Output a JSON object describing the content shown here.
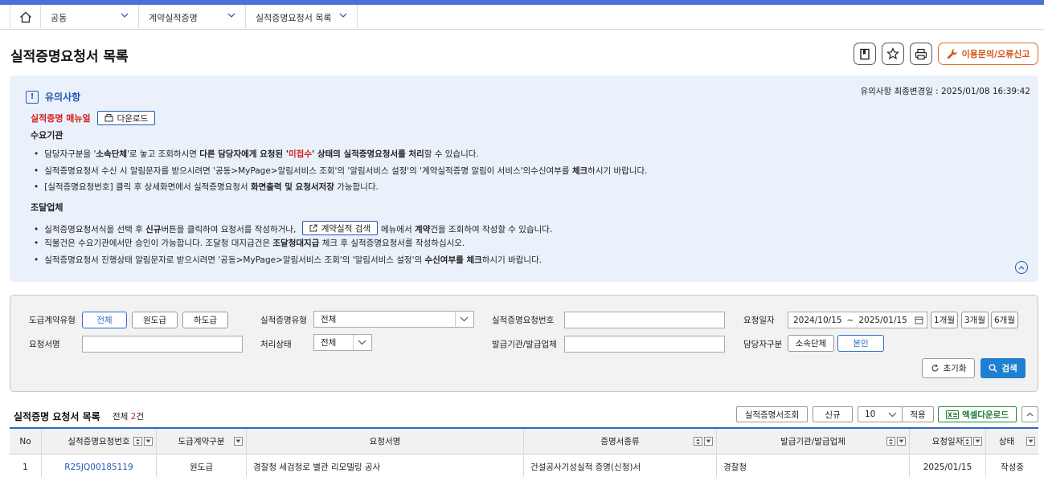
{
  "breadcrumb": {
    "items": [
      "공동",
      "계약실적증명",
      "실적증명요청서 목록"
    ]
  },
  "page": {
    "title": "실적증명요청서 목록",
    "inquiry_button": "이용문의/오류신고"
  },
  "notice": {
    "heading": "유의사항",
    "updated_label": "유의사항 최종변경일 : 2025/01/08 16:39:42",
    "manual_label": "실적증명 매뉴얼",
    "download_button": "다운로드",
    "section1_title": "수요기관",
    "s1_l1_a": "담당자구분을 '",
    "s1_l1_b": "소속단체",
    "s1_l1_c": "'로 놓고 조회하시면 ",
    "s1_l1_d": "다른 담당자에게 요청된 '",
    "s1_l1_e": "미접수",
    "s1_l1_f": "' 상태의 실적증명요청서를 처리",
    "s1_l1_g": "할 수 있습니다.",
    "s1_l2_a": "실적증명요청서 수신 시 알림문자를 받으시려면 '공동>MyPage>알림서비스 조회'의 '알림서비스 설정'의 '계약실적증명 알림이 서비스'의수신여부를 ",
    "s1_l2_b": "체크",
    "s1_l2_c": "하시기 바랍니다.",
    "s1_l3_a": "[실적증명요청번호] 클릭 후 상세화면에서 실적증명요청서 ",
    "s1_l3_b": "화면출력 및 요청서저장",
    "s1_l3_c": " 가능합니다.",
    "section2_title": "조달업체",
    "s2_l1_a": "실적증명요청서식을 선택 후 ",
    "s2_l1_b": "신규",
    "s2_l1_c": "버튼을 클릭하여 요청서를 작성하거나,",
    "s2_l1_btn": "계약실적 검색",
    "s2_l1_d": "메뉴에서 ",
    "s2_l1_e": "계약",
    "s2_l1_f": "건을 조회하여 작성할 수 있습니다.",
    "s2_l2_a": "직불건은 수요기관에서만 승인이 가능합니다. 조달청 대지급건은 ",
    "s2_l2_b": "조달청대지급",
    "s2_l2_c": " 체크 후 실적증명요청서를 작성하십시오.",
    "s2_l3_a": "실적증명요청서 진행상태 알림문자로 받으시려면 '공동>MyPage>알림서비스 조회'의 '알림서비스 설정'의 ",
    "s2_l3_b": "수신여부를 체크",
    "s2_l3_c": "하시기 바랍니다."
  },
  "filter": {
    "contract_type_label": "도급계약유형",
    "contract_type_options": [
      "전체",
      "원도급",
      "하도급"
    ],
    "cert_type_label": "실적증명유형",
    "cert_type_value": "전체",
    "req_no_label": "실적증명요청번호",
    "req_no_value": "",
    "req_date_label": "요청일자",
    "date_from": "2024/10/15",
    "date_sep": "~",
    "date_to": "2025/01/15",
    "period_buttons": [
      "1개월",
      "3개월",
      "6개월"
    ],
    "req_name_label": "요청서명",
    "req_name_value": "",
    "status_label": "처리상태",
    "status_value": "전체",
    "issuer_label": "발급기관/발급업체",
    "issuer_value": "",
    "manager_label": "담당자구분",
    "manager_options": [
      "소속단체",
      "본인"
    ],
    "reset_button": "초기화",
    "search_button": "검색"
  },
  "list": {
    "title": "실적증명 요청서 목록",
    "count_prefix": "전체 ",
    "count": "2",
    "count_suffix": "건",
    "btn_view": "실적증명서조회",
    "btn_new": "신규",
    "page_size": "10",
    "btn_apply": "적용",
    "btn_excel": "엑셀다운로드",
    "columns": [
      "No",
      "실적증명요청번호",
      "도급계약구분",
      "요청서명",
      "증명서종류",
      "발급기관/발급업체",
      "요청일자",
      "상태"
    ],
    "rows": [
      {
        "no": "1",
        "req_no": "R25JQ00185119",
        "contract": "원도급",
        "name": "경찰청 세검청로 별관 리모델링 공사",
        "cert_kind": "건설공사기성실적 증명(신청)서",
        "issuer": "경찰청",
        "date": "2025/01/15",
        "status": "작성중"
      }
    ]
  }
}
